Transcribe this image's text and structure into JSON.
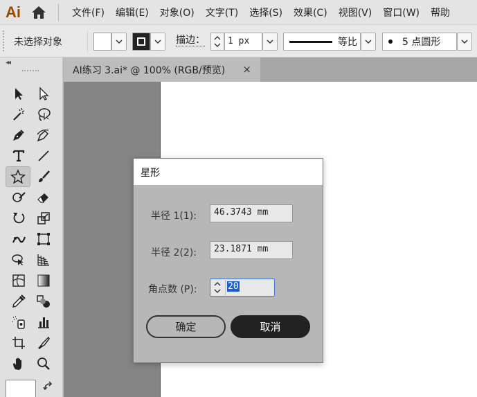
{
  "app": {
    "logo": "Ai",
    "menus": [
      "文件(F)",
      "编辑(E)",
      "对象(O)",
      "文字(T)",
      "选择(S)",
      "效果(C)",
      "视图(V)",
      "窗口(W)",
      "帮助"
    ]
  },
  "control_bar": {
    "selection_status": "未选择对象",
    "stroke_label": "描边：",
    "stroke_weight": "1 px",
    "variable_width_profile": "等比",
    "brush_definition": "5 点圆形"
  },
  "document_tab": {
    "title": "AI练习 3.ai* @ 100% (RGB/预览)",
    "close": "×"
  },
  "dialog": {
    "title": "星形",
    "radius1_label": "半径 1(1):",
    "radius1_value": "46.3743 mm",
    "radius2_label": "半径 2(2):",
    "radius2_value": "23.1871 mm",
    "points_label": "角点数 (P):",
    "points_value": "20",
    "ok_label": "确定",
    "cancel_label": "取消"
  },
  "colors": {
    "logo": "#9a4a00",
    "selection_highlight": "#1a5fd6",
    "dialog_bg": "#b7b7b7",
    "pasteboard": "#858585"
  },
  "tools": [
    "selection-tool",
    "direct-selection-tool",
    "magic-wand-tool",
    "lasso-tool",
    "pen-tool",
    "curvature-tool",
    "type-tool",
    "line-segment-tool",
    "star-tool",
    "paintbrush-tool",
    "shaper-tool",
    "eraser-tool",
    "rotate-tool",
    "scale-tool",
    "puppet-warp-tool",
    "free-transform-tool",
    "shape-builder-tool",
    "perspective-grid-tool",
    "mesh-tool",
    "gradient-tool",
    "eyedropper-tool",
    "blend-tool",
    "symbol-sprayer-tool",
    "column-graph-tool",
    "artboard-tool",
    "slice-tool",
    "hand-tool",
    "zoom-tool"
  ]
}
